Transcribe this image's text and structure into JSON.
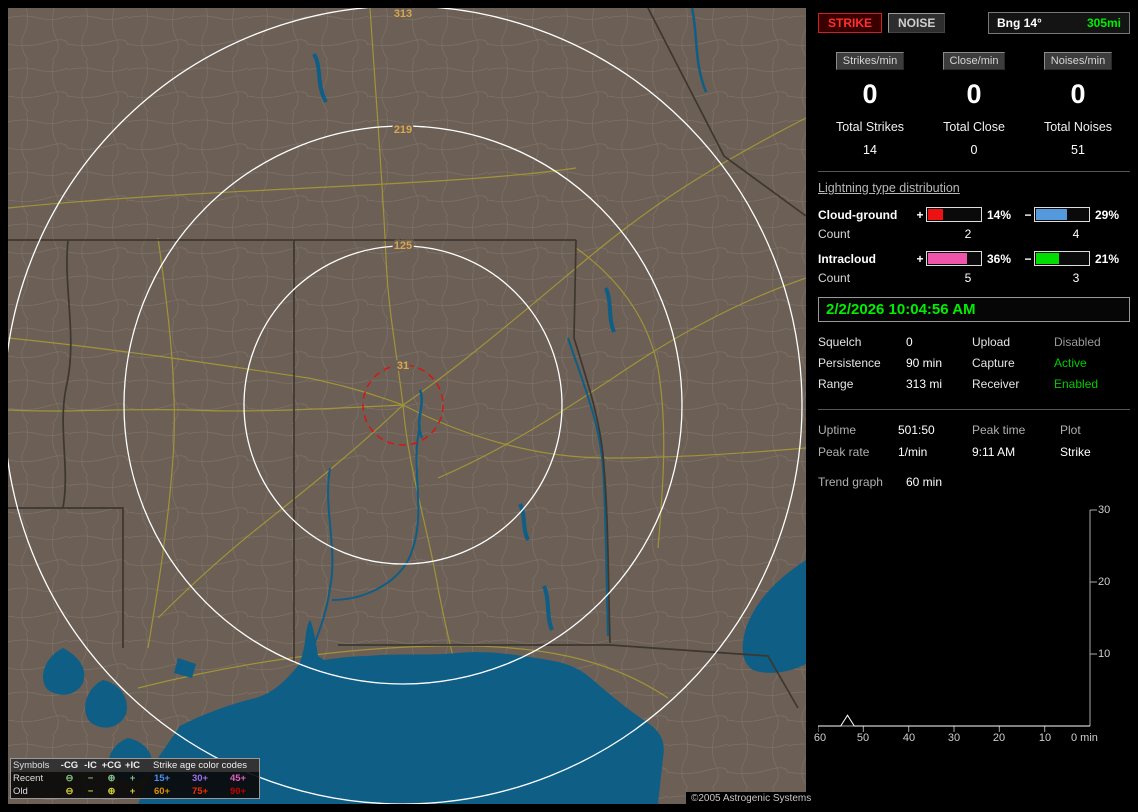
{
  "colors": {
    "land": "#6c5f55",
    "water": "#0e5e86",
    "road": "#a59a35",
    "ring": "#ffffff",
    "ring_label": "#d8a84e",
    "alert_red": "#dd1111",
    "status_green": "#00cc00",
    "time_green": "#00ee00"
  },
  "map": {
    "rings": [
      {
        "label": "313"
      },
      {
        "label": "219"
      },
      {
        "label": "125"
      },
      {
        "label": "31"
      }
    ],
    "credit": "©2005 Astrogenic Systems",
    "legend": {
      "symbols_header": "Symbols",
      "columns": [
        "-CG",
        "-IC",
        "+CG",
        "+IC"
      ],
      "age_header": "Strike age color codes",
      "glyphs": [
        "⊖",
        "−",
        "⊕",
        "+"
      ],
      "rows": [
        {
          "label": "Recent",
          "symbol_color": "#7fbf7f",
          "ages": [
            {
              "text": "15+",
              "color": "#4f8fef"
            },
            {
              "text": "30+",
              "color": "#9a6fef"
            },
            {
              "text": "45+",
              "color": "#e060c0"
            }
          ]
        },
        {
          "label": "Old",
          "symbol_color": "#cccc33",
          "ages": [
            {
              "text": "60+",
              "color": "#e09000"
            },
            {
              "text": "75+",
              "color": "#f03000"
            },
            {
              "text": "90+",
              "color": "#c00000"
            }
          ]
        }
      ]
    }
  },
  "panel": {
    "strike_button": "STRIKE",
    "noise_button": "NOISE",
    "bearing_label": "Bng 14°",
    "bearing_distance": "305mi",
    "rates": [
      {
        "label": "Strikes/min",
        "value": "0"
      },
      {
        "label": "Close/min",
        "value": "0"
      },
      {
        "label": "Noises/min",
        "value": "0"
      }
    ],
    "totals": [
      {
        "label": "Total Strikes",
        "value": "14"
      },
      {
        "label": "Total Close",
        "value": "0"
      },
      {
        "label": "Total Noises",
        "value": "51"
      }
    ],
    "distribution": {
      "title": "Lightning type distribution",
      "plus_sign": "+",
      "minus_sign": "−",
      "count_label": "Count",
      "rows": [
        {
          "name": "Cloud-ground",
          "pos": {
            "pct": "14%",
            "value": 14,
            "color": "#ee1111",
            "count": "2"
          },
          "neg": {
            "pct": "29%",
            "value": 29,
            "color": "#5599dd",
            "count": "4"
          }
        },
        {
          "name": "Intracloud",
          "pos": {
            "pct": "36%",
            "value": 36,
            "color": "#ee55aa",
            "count": "5"
          },
          "neg": {
            "pct": "21%",
            "value": 21,
            "color": "#00dd00",
            "count": "3"
          }
        }
      ]
    },
    "datetime": "2/2/2026 10:04:56 AM",
    "settings": [
      {
        "label": "Squelch",
        "value": "0",
        "label2": "Upload",
        "value2": "Disabled",
        "value2_color": "#9a9a9a"
      },
      {
        "label": "Persistence",
        "value": "90 min",
        "label2": "Capture",
        "value2": "Active",
        "value2_color": "#00cc00"
      },
      {
        "label": "Range",
        "value": "313 mi",
        "label2": "Receiver",
        "value2": "Enabled",
        "value2_color": "#00cc00"
      }
    ],
    "status": {
      "uptime_label": "Uptime",
      "uptime": "501:50",
      "peak_time_label": "Peak time",
      "plot_label": "Plot",
      "peak_rate_label": "Peak rate",
      "peak_rate": "1/min",
      "peak_time": "9:11 AM",
      "plot_value": "Strike",
      "trend_label": "Trend graph",
      "trend_window": "60 min"
    }
  },
  "chart_data": {
    "type": "line",
    "title": "Strike rate trend (last 60 min)",
    "xlabel": "min",
    "ylabel": "",
    "x_ticks": [
      "60",
      "50",
      "40",
      "30",
      "20",
      "10"
    ],
    "x_end_label": "0 min",
    "y_ticks": [
      "30",
      "20",
      "10"
    ],
    "xlim": [
      60,
      0
    ],
    "ylim": [
      0,
      30
    ],
    "grid": false,
    "legend_position": "none",
    "series": [
      {
        "name": "Strikes/min",
        "points": [
          [
            60,
            0
          ],
          [
            55,
            0
          ],
          [
            53.5,
            1.5
          ],
          [
            52,
            0
          ],
          [
            0,
            0
          ]
        ]
      }
    ]
  }
}
